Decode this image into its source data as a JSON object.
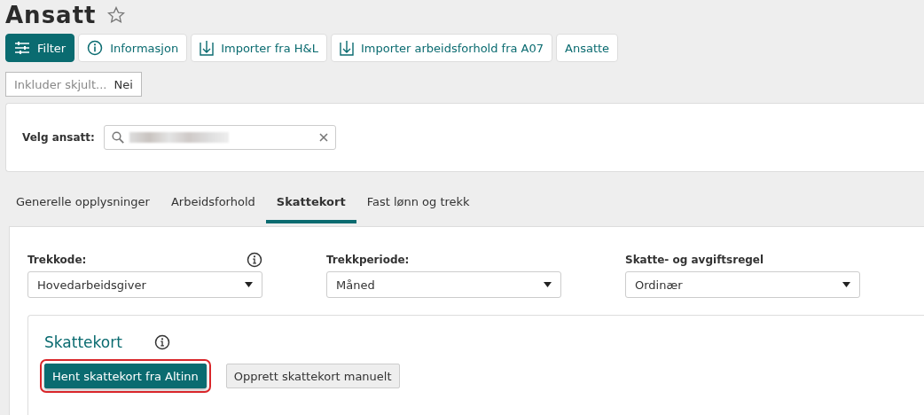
{
  "page": {
    "title": "Ansatt",
    "favorite": false
  },
  "toolbar": [
    {
      "label": "Filter",
      "kind": "filter"
    },
    {
      "label": "Informasjon",
      "kind": "info"
    },
    {
      "label": "Importer fra H&L",
      "kind": "import"
    },
    {
      "label": "Importer arbeidsforhold fra A07",
      "kind": "import"
    },
    {
      "label": "Ansatte",
      "kind": "plain"
    }
  ],
  "filter": {
    "label": "Inkluder skjult...",
    "value": "Nei"
  },
  "employee_select": {
    "label": "Velg ansatt:",
    "value_obscured": true
  },
  "tabs": [
    {
      "label": "Generelle opplysninger",
      "selected": false
    },
    {
      "label": "Arbeidsforhold",
      "selected": false
    },
    {
      "label": "Skattekort",
      "selected": true
    },
    {
      "label": "Fast lønn og trekk",
      "selected": false
    }
  ],
  "fields": [
    {
      "label": "Trekkode:",
      "value": "Hovedarbeidsgiver",
      "info": true
    },
    {
      "label": "Trekkperiode:",
      "value": "Måned",
      "info": false
    },
    {
      "label": "Skatte- og avgiftsregel",
      "value": "Ordinær",
      "info": false
    }
  ],
  "skattekort": {
    "title": "Skattekort",
    "buttons": [
      {
        "label": "Hent skattekort fra Altinn",
        "kind": "primary",
        "highlighted": true
      },
      {
        "label": "Opprett skattekort manuelt",
        "kind": "secondary",
        "highlighted": false
      }
    ]
  }
}
